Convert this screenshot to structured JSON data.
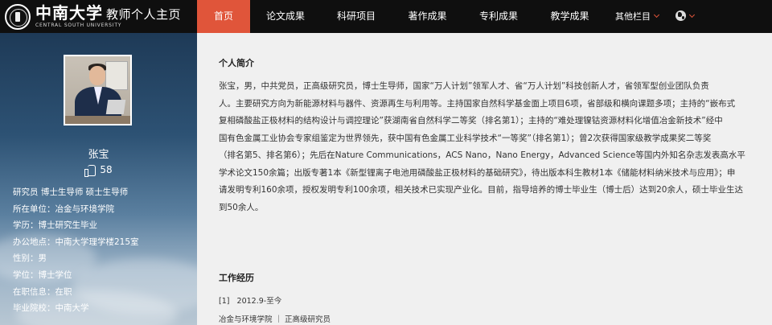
{
  "header": {
    "logo": {
      "name": "中南大学",
      "subtitle": "教师个人主页",
      "english": "CENTRAL SOUTH UNIVERSITY"
    },
    "nav": [
      {
        "label": "首页",
        "active": true
      },
      {
        "label": "论文成果"
      },
      {
        "label": "科研项目"
      },
      {
        "label": "著作成果"
      },
      {
        "label": "专利成果"
      },
      {
        "label": "教学成果"
      },
      {
        "label": "其他栏目"
      }
    ],
    "accent_color": "#e0553a"
  },
  "profile": {
    "name": "张宝",
    "likes": "58",
    "info": [
      "研究员 博士生导师 硕士生导师",
      "所在单位：冶金与环境学院",
      "学历：博士研究生毕业",
      "办公地点：中南大学理学楼215室",
      "性别：男",
      "学位：博士学位",
      "在职信息：在职",
      "毕业院校：中南大学"
    ]
  },
  "main": {
    "intro_title": "个人简介",
    "bio": [
      "张宝，男，中共党员，正高级研究员，博士生导师，国家“万人计划”领军人才、省“万人计划”科技创新人才，省领军型创业团队负责",
      "人。主要研究方向为新能源材料与器件、资源再生与利用等。主持国家自然科学基金面上项目6项，省部级和横向课题多项；主持的“嵌布式",
      "复相磷酸盐正极材料的结构设计与调控理论”获湖南省自然科学二等奖（排名第1）；主持的“难处理镍钴资源材料化增值冶金新技术”经中",
      "国有色金属工业协会专家组鉴定为世界领先，获中国有色金属工业科学技术“一等奖”（排名第1）；曾2次获得国家级教学成果奖二等奖",
      "（排名第5、排名第6）；先后在Nature Communications，ACS Nano，Nano Energy，Advanced Science等国内外知名杂志发表高水平",
      "学术论文150余篇；出版专著1本《新型锂离子电池用磷酸盐正极材料的基础研究》，待出版本科生教材1本《储能材料纳米技术与应用》；申",
      "请发明专利160余项，授权发明专利100余项，相关技术已实现产业化。目前，指导培养的博士毕业生（博士后）达到20余人，硕士毕业生达",
      "到50余人。"
    ],
    "work_title": "工作经历",
    "work": [
      {
        "index": "[1]",
        "period": "2012.9-至今",
        "detail": "冶金与环境学院 ｜ 正高级研究员"
      }
    ]
  }
}
